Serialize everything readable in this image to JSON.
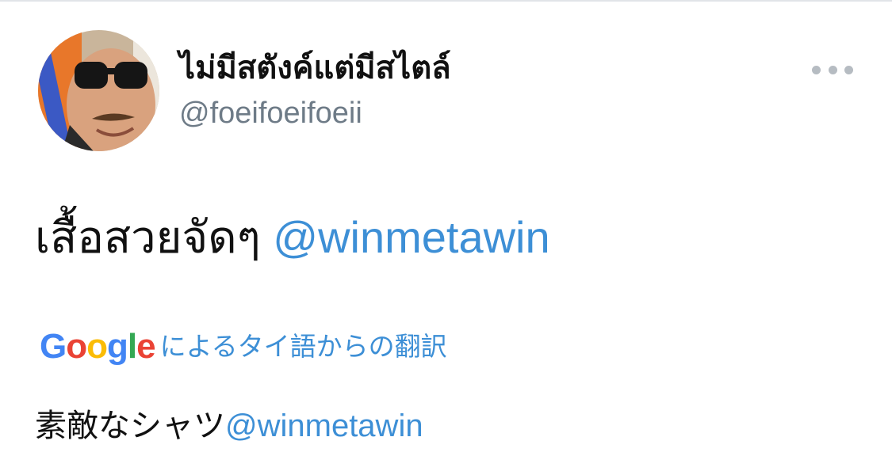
{
  "tweet": {
    "author": {
      "display_name": "ไม่มีสตังค์แต่มีสไตล์",
      "handle": "@foeifoeifoeii",
      "avatar_icon": "avatar-photo"
    },
    "more_icon": "more-horizontal-icon",
    "text": "เสื้อสวยจัดๆ",
    "mention": "@winmetawin"
  },
  "translation": {
    "provider_logo": "Google",
    "label": "によるタイ語からの翻訳",
    "text": "素敵なシャツ",
    "mention": "@winmetawin"
  },
  "colors": {
    "link": "#3d8fd6",
    "handle": "#6e7b87",
    "text": "#111111",
    "more_dots": "#b6bcc2"
  }
}
